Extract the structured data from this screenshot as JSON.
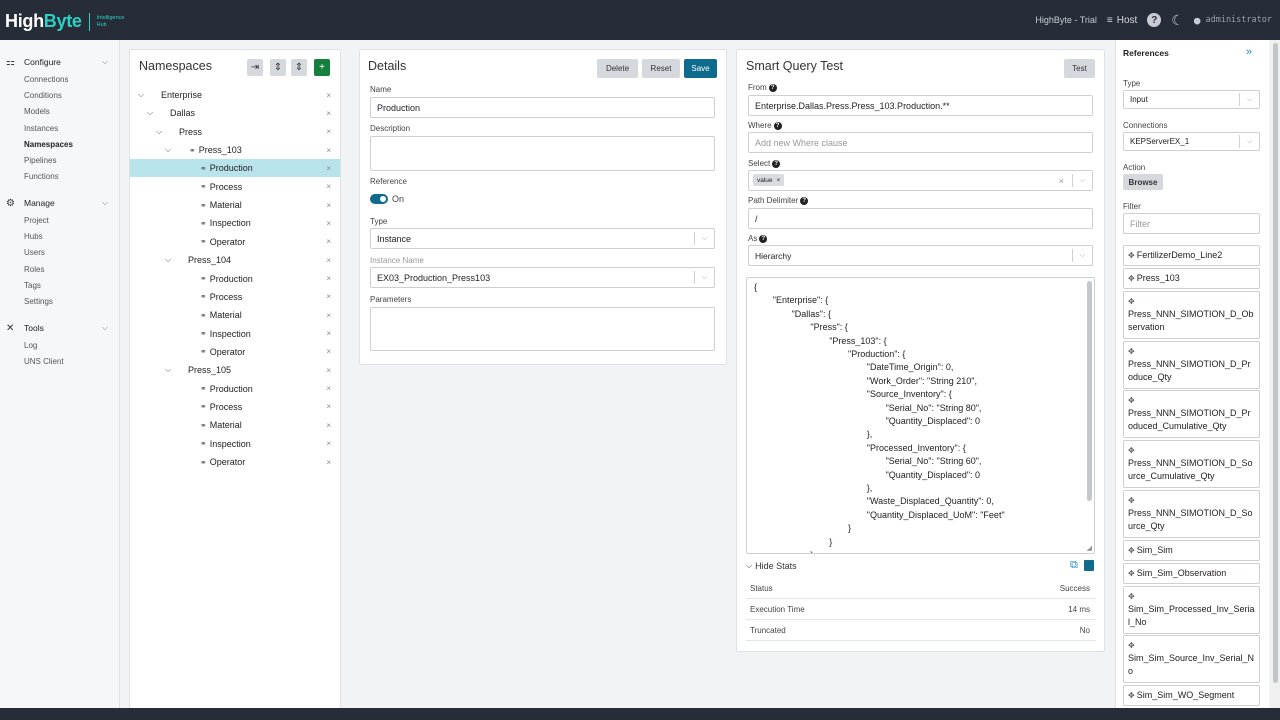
{
  "header": {
    "brand_high": "High",
    "brand_byte": "Byte",
    "brand_sub1": "Intelligence",
    "brand_sub2": "Hub",
    "instance": "HighByte - Trial",
    "host_label": "Host",
    "user": "administrator"
  },
  "nav": {
    "configure": {
      "label": "Configure",
      "items": [
        "Connections",
        "Conditions",
        "Models",
        "Instances",
        "Namespaces",
        "Pipelines",
        "Functions"
      ]
    },
    "manage": {
      "label": "Manage",
      "items": [
        "Project",
        "Hubs",
        "Users",
        "Roles",
        "Tags",
        "Settings"
      ]
    },
    "tools": {
      "label": "Tools",
      "items": [
        "Log",
        "UNS Client"
      ]
    },
    "active": "Namespaces"
  },
  "namespaces": {
    "title": "Namespaces",
    "tree": [
      {
        "label": "Enterprise",
        "depth": 0,
        "expand": true,
        "link": false
      },
      {
        "label": "Dallas",
        "depth": 1,
        "expand": true,
        "link": false
      },
      {
        "label": "Press",
        "depth": 2,
        "expand": true,
        "link": false
      },
      {
        "label": "Press_103",
        "depth": 3,
        "expand": true,
        "link": true
      },
      {
        "label": "Production",
        "depth": 4,
        "expand": false,
        "link": true,
        "selected": true
      },
      {
        "label": "Process",
        "depth": 4,
        "expand": false,
        "link": true
      },
      {
        "label": "Material",
        "depth": 4,
        "expand": false,
        "link": true
      },
      {
        "label": "Inspection",
        "depth": 4,
        "expand": false,
        "link": true
      },
      {
        "label": "Operator",
        "depth": 4,
        "expand": false,
        "link": true
      },
      {
        "label": "Press_104",
        "depth": 3,
        "expand": true,
        "link": false
      },
      {
        "label": "Production",
        "depth": 4,
        "expand": false,
        "link": true
      },
      {
        "label": "Process",
        "depth": 4,
        "expand": false,
        "link": true
      },
      {
        "label": "Material",
        "depth": 4,
        "expand": false,
        "link": true
      },
      {
        "label": "Inspection",
        "depth": 4,
        "expand": false,
        "link": true
      },
      {
        "label": "Operator",
        "depth": 4,
        "expand": false,
        "link": true
      },
      {
        "label": "Press_105",
        "depth": 3,
        "expand": true,
        "link": false
      },
      {
        "label": "Production",
        "depth": 4,
        "expand": false,
        "link": true
      },
      {
        "label": "Process",
        "depth": 4,
        "expand": false,
        "link": true
      },
      {
        "label": "Material",
        "depth": 4,
        "expand": false,
        "link": true
      },
      {
        "label": "Inspection",
        "depth": 4,
        "expand": false,
        "link": true
      },
      {
        "label": "Operator",
        "depth": 4,
        "expand": false,
        "link": true
      }
    ]
  },
  "details": {
    "title": "Details",
    "delete": "Delete",
    "reset": "Reset",
    "save": "Save",
    "name_label": "Name",
    "name_value": "Production",
    "description_label": "Description",
    "reference_label": "Reference",
    "reference_state": "On",
    "type_label": "Type",
    "type_value": "Instance",
    "instance_name_label": "Instance Name",
    "instance_name_value": "EX03_Production_Press103",
    "parameters_label": "Parameters"
  },
  "smart_query": {
    "title": "Smart Query Test",
    "test": "Test",
    "from_label": "From",
    "from_value": "Enterprise.Dallas.Press.Press_103.Production.**",
    "where_label": "Where",
    "where_placeholder": "Add new Where clause",
    "select_label": "Select",
    "select_chip": "value",
    "path_delim_label": "Path Delimiter",
    "path_delim_value": "/",
    "as_label": "As",
    "as_value": "Hierarchy",
    "json_lines": [
      {
        "t": "{",
        "d": 0
      },
      {
        "t": "\"Enterprise\": {",
        "d": 1
      },
      {
        "t": "\"Dallas\": {",
        "d": 2
      },
      {
        "t": "\"Press\": {",
        "d": 3
      },
      {
        "t": "\"Press_103\": {",
        "d": 4
      },
      {
        "t": "\"Production\": {",
        "d": 5
      },
      {
        "t": "\"DateTime_Origin\": 0,",
        "d": 6
      },
      {
        "t": "\"Work_Order\": \"String 210\",",
        "d": 6
      },
      {
        "t": "\"Source_Inventory\": {",
        "d": 6
      },
      {
        "t": "\"Serial_No\": \"String 80\",",
        "d": 7
      },
      {
        "t": "\"Quantity_Displaced\": 0",
        "d": 7
      },
      {
        "t": "},",
        "d": 6
      },
      {
        "t": "\"Processed_Inventory\": {",
        "d": 6
      },
      {
        "t": "\"Serial_No\": \"String 60\",",
        "d": 7
      },
      {
        "t": "\"Quantity_Displaced\": 0",
        "d": 7
      },
      {
        "t": "},",
        "d": 6
      },
      {
        "t": "\"Waste_Displaced_Quantity\": 0,",
        "d": 6
      },
      {
        "t": "\"Quantity_Displaced_UoM\": \"Feet\"",
        "d": 6
      },
      {
        "t": "}",
        "d": 5
      },
      {
        "t": "}",
        "d": 4
      },
      {
        "t": "}",
        "d": 3
      }
    ],
    "hide_stats": "Hide Stats",
    "stats": [
      {
        "k": "Status",
        "v": "Success"
      },
      {
        "k": "Execution Time",
        "v": "14 ms"
      },
      {
        "k": "Truncated",
        "v": "No"
      }
    ]
  },
  "references": {
    "title": "References",
    "type_label": "Type",
    "type_value": "Input",
    "connections_label": "Connections",
    "connections_value": "KEPServerEX_1",
    "action_label": "Action",
    "action_value": "Browse",
    "filter_label": "Filter",
    "filter_placeholder": "Filter",
    "items": [
      {
        "label": "FertilizerDemo_Line2",
        "multi": false
      },
      {
        "label": "Press_103",
        "multi": false
      },
      {
        "label": "Press_NNN_SIMOTION_D_Observation",
        "multi": true
      },
      {
        "label": "Press_NNN_SIMOTION_D_Produce_Qty",
        "multi": true
      },
      {
        "label": "Press_NNN_SIMOTION_D_Produced_Cumulative_Qty",
        "multi": true
      },
      {
        "label": "Press_NNN_SIMOTION_D_Source_Cumulative_Qty",
        "multi": true
      },
      {
        "label": "Press_NNN_SIMOTION_D_Source_Qty",
        "multi": true
      },
      {
        "label": "Sim_Sim",
        "multi": false
      },
      {
        "label": "Sim_Sim_Observation",
        "multi": false
      },
      {
        "label": "Sim_Sim_Processed_Inv_Serial_No",
        "multi": true
      },
      {
        "label": "Sim_Sim_Source_Inv_Serial_No",
        "multi": true
      },
      {
        "label": "Sim_Sim_WO_Segment",
        "multi": false
      }
    ]
  },
  "colors": {
    "topbar": "#272d38",
    "accent": "#2ad1c4",
    "primary": "#0e6b8e",
    "selected_row": "#b9e3ea",
    "add_button": "#15803d"
  }
}
